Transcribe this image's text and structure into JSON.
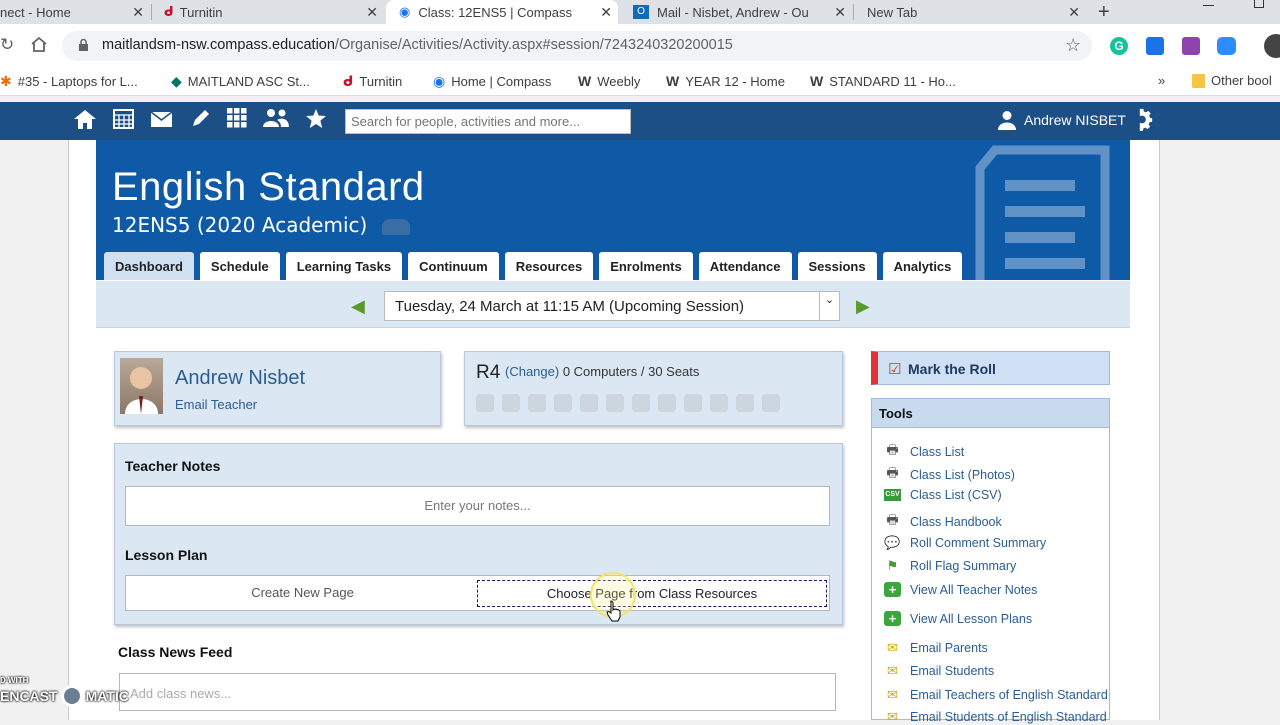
{
  "browser": {
    "tabs": [
      {
        "title": "nect - Home",
        "close": "✕"
      },
      {
        "title": "Turnitin",
        "close": "✕"
      },
      {
        "title": "Class: 12ENS5 | Compass",
        "close": "✕"
      },
      {
        "title": "Mail - Nisbet, Andrew - Ou",
        "close": "✕"
      },
      {
        "title": "New Tab",
        "close": "✕"
      }
    ],
    "new_tab": "+",
    "url_host": "maitlandsm-nsw.compass.education",
    "url_path": "/Organise/Activities/Activity.aspx#session/7243240320200015",
    "bookmarks": [
      "#35 - Laptops for L...",
      "MAITLAND ASC St...",
      "Turnitin",
      "Home | Compass",
      "Weebly",
      "YEAR 12 - Home",
      "STANDARD 11 - Ho..."
    ],
    "bookmarks_more": "»",
    "other_bookmarks": "Other bool"
  },
  "nav": {
    "search_placeholder": "Search for people, activities and more...",
    "user_name": "Andrew NISBET"
  },
  "banner": {
    "title": "English Standard",
    "subtitle": "12ENS5 (2020 Academic)"
  },
  "class_tabs": [
    "Dashboard",
    "Schedule",
    "Learning Tasks",
    "Continuum",
    "Resources",
    "Enrolments",
    "Attendance",
    "Sessions",
    "Analytics"
  ],
  "session": {
    "selected": "Tuesday, 24 March at 11:15 AM (Upcoming Session)",
    "prev": "◀",
    "next": "▶"
  },
  "teacher": {
    "name": "Andrew Nisbet",
    "email_link": "Email Teacher"
  },
  "room": {
    "code": "R4",
    "change": "(Change)",
    "info": "0 Computers / 30 Seats"
  },
  "teacher_notes": {
    "heading": "Teacher Notes",
    "placeholder": "Enter your notes..."
  },
  "lesson_plan": {
    "heading": "Lesson Plan",
    "create": "Create New Page",
    "choose": "Choose Page from Class Resources"
  },
  "news_feed": {
    "heading": "Class News Feed",
    "placeholder": "Add class news..."
  },
  "sidebar": {
    "mark_roll": "Mark the Roll",
    "tools_heading": "Tools",
    "tools": [
      {
        "label": "Class List",
        "icon": "printer-icon"
      },
      {
        "label": "Class List (Photos)",
        "icon": "printer-icon"
      },
      {
        "label": "Class List (CSV)",
        "icon": "csv-icon"
      },
      {
        "label": "Class Handbook",
        "icon": "printer-icon"
      },
      {
        "label": "Roll Comment Summary",
        "icon": "comment-icon"
      },
      {
        "label": "Roll Flag Summary",
        "icon": "flag-icon"
      },
      {
        "label": "View All Teacher Notes",
        "icon": "add-icon"
      },
      {
        "label": "View All Lesson Plans",
        "icon": "add-icon"
      },
      {
        "label": "Email Parents",
        "icon": "envelope-icon"
      },
      {
        "label": "Email Students",
        "icon": "envelope-icon"
      },
      {
        "label": "Email Teachers of English Standard",
        "icon": "envelope-icon"
      },
      {
        "label": "Email Students of English Standard",
        "icon": "envelope-icon"
      }
    ]
  },
  "watermark": {
    "line1": "D WITH",
    "line2": "ENCAST",
    "line3": "MATIC"
  }
}
